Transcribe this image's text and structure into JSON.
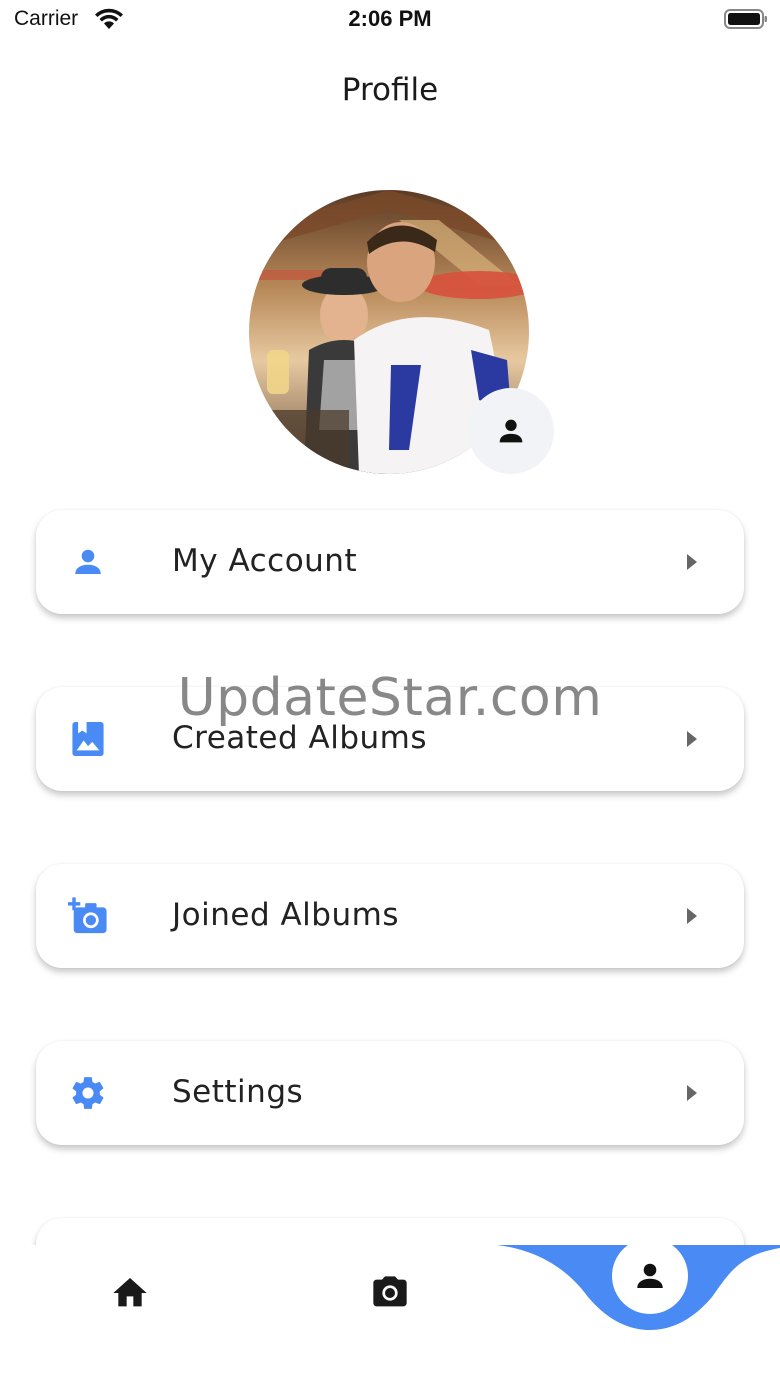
{
  "status_bar": {
    "carrier": "Carrier",
    "time": "2:06 PM"
  },
  "header": {
    "title": "Profile"
  },
  "profile": {
    "avatar_icon": "person-icon",
    "badge_icon": "person-icon"
  },
  "menu": {
    "items": [
      {
        "label": "My Account",
        "icon": "person-icon"
      },
      {
        "label": "Created Albums",
        "icon": "photo-album-icon"
      },
      {
        "label": "Joined Albums",
        "icon": "add-camera-icon"
      },
      {
        "label": "Settings",
        "icon": "gear-icon"
      },
      {
        "label": "",
        "icon": ""
      }
    ]
  },
  "watermark": "UpdateStar.com",
  "bottom_nav": {
    "items": [
      {
        "icon": "home-icon"
      },
      {
        "icon": "camera-icon"
      },
      {
        "icon": "person-icon",
        "active": true
      }
    ]
  },
  "colors": {
    "accent": "#4a8af4",
    "text": "#222222",
    "card_bg": "#ffffff"
  }
}
